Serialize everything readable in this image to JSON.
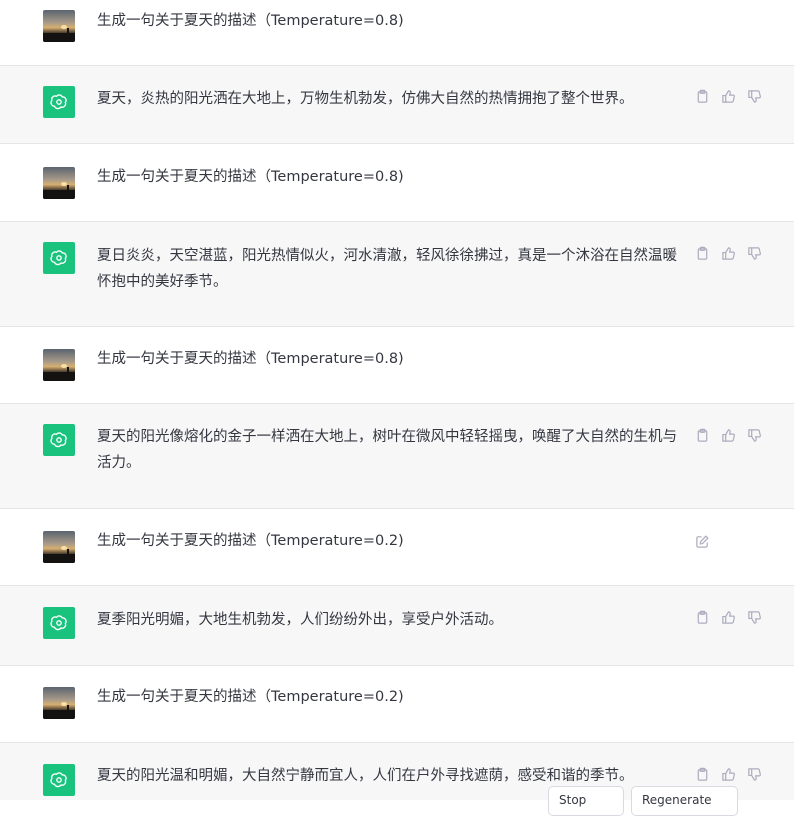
{
  "conversation": [
    {
      "role": "user",
      "text": "生成一句关于夏天的描述（Temperature=0.8)"
    },
    {
      "role": "assistant",
      "text": "夏天，炎热的阳光洒在大地上，万物生机勃发，仿佛大自然的热情拥抱了整个世界。"
    },
    {
      "role": "user",
      "text": "生成一句关于夏天的描述（Temperature=0.8)"
    },
    {
      "role": "assistant",
      "text": "夏日炎炎，天空湛蓝，阳光热情似火，河水清澈，轻风徐徐拂过，真是一个沐浴在自然温暖\n怀抱中的美好季节。"
    },
    {
      "role": "user",
      "text": "生成一句关于夏天的描述（Temperature=0.8)"
    },
    {
      "role": "assistant",
      "text": "夏天的阳光像熔化的金子一样洒在大地上，树叶在微风中轻轻摇曳，唤醒了大自然的生机与\n活力。"
    },
    {
      "role": "user",
      "text": "生成一句关于夏天的描述（Temperature=0.2)",
      "editable": true
    },
    {
      "role": "assistant",
      "text": "夏季阳光明媚，大地生机勃发，人们纷纷外出，享受户外活动。"
    },
    {
      "role": "user",
      "text": "生成一句关于夏天的描述（Temperature=0.2)"
    },
    {
      "role": "assistant",
      "text": "夏天的阳光温和明媚，大自然宁静而宜人，人们在户外寻找遮荫，感受和谐的季节。"
    }
  ],
  "icons": {
    "copy": "clipboard-icon",
    "like": "thumbs-up-icon",
    "dislike": "thumbs-down-icon",
    "edit": "edit-icon",
    "assistant_logo": "openai-logo-icon"
  },
  "colors": {
    "assistant_bg": "#f7f7f8",
    "user_bg": "#ffffff",
    "logo_bg": "#19c37d",
    "text": "#353740",
    "icon": "#acacbe"
  },
  "footer": {
    "button_1": "Stop",
    "button_2": "Regenerate"
  }
}
